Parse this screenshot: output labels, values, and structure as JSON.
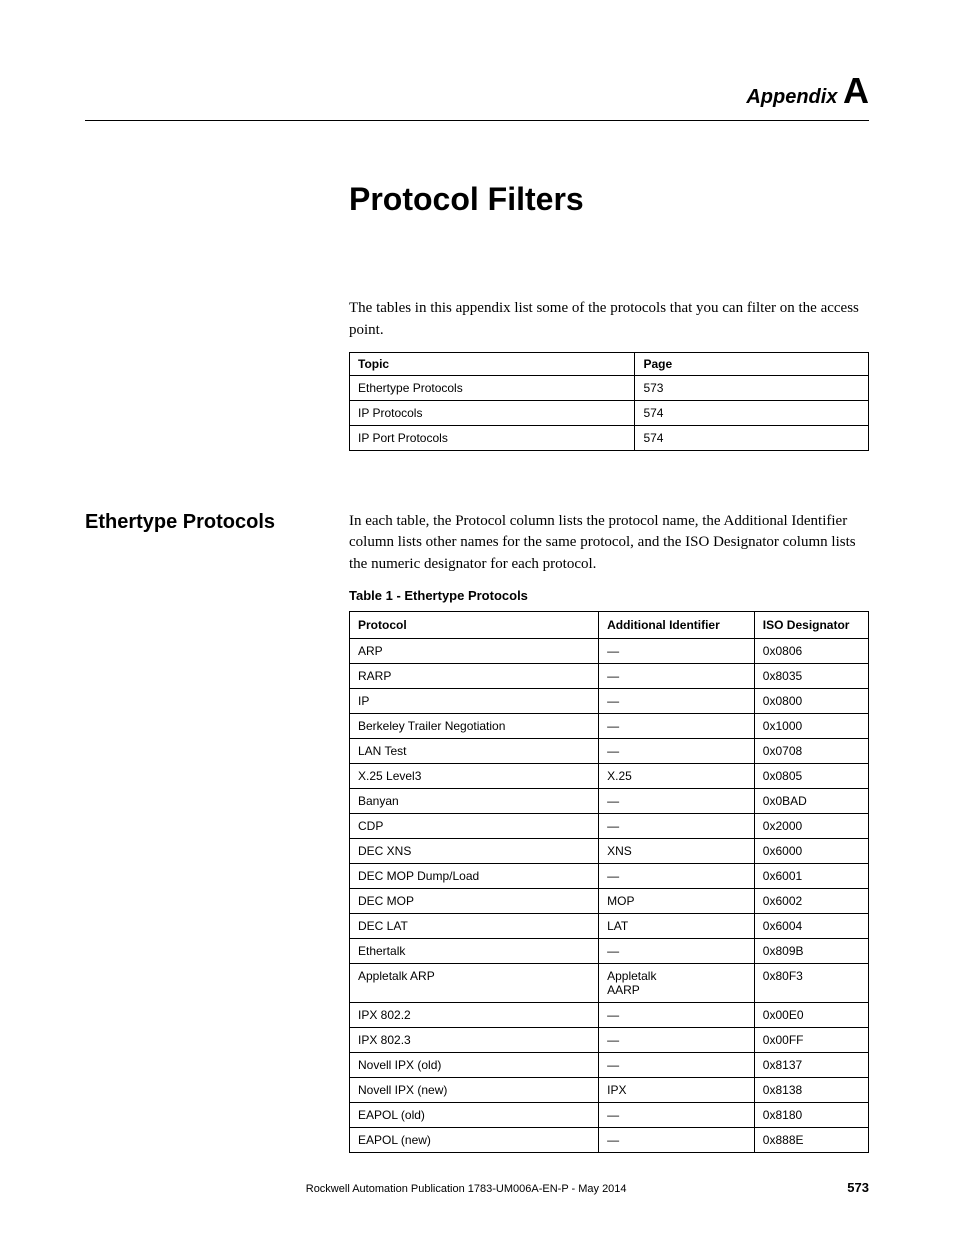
{
  "header": {
    "appendix_word": "Appendix",
    "appendix_letter": "A"
  },
  "title": "Protocol Filters",
  "intro": "The tables in this appendix list some of the protocols that you can filter on the access point.",
  "toc": {
    "headers": [
      "Topic",
      "Page"
    ],
    "rows": [
      [
        "Ethertype Protocols",
        "573"
      ],
      [
        "IP Protocols",
        "574"
      ],
      [
        "IP Port Protocols",
        "574"
      ]
    ]
  },
  "section": {
    "heading": "Ethertype Protocols",
    "body": "In each table, the Protocol column lists the protocol name, the Additional Identifier column lists other names for the same protocol, and the ISO Designator column lists the numeric designator for each protocol.",
    "table_caption": "Table 1 - Ethertype Protocols"
  },
  "chart_data": {
    "type": "table",
    "headers": [
      "Protocol",
      "Additional Identifier",
      "ISO Designator"
    ],
    "rows": [
      [
        "ARP",
        "—",
        "0x0806"
      ],
      [
        "RARP",
        "—",
        "0x8035"
      ],
      [
        "IP",
        "—",
        "0x0800"
      ],
      [
        "Berkeley Trailer Negotiation",
        "—",
        "0x1000"
      ],
      [
        "LAN Test",
        "—",
        "0x0708"
      ],
      [
        "X.25 Level3",
        "X.25",
        "0x0805"
      ],
      [
        "Banyan",
        "—",
        "0x0BAD"
      ],
      [
        "CDP",
        "—",
        "0x2000"
      ],
      [
        "DEC XNS",
        "XNS",
        "0x6000"
      ],
      [
        "DEC MOP Dump/Load",
        "—",
        "0x6001"
      ],
      [
        "DEC MOP",
        "MOP",
        "0x6002"
      ],
      [
        "DEC LAT",
        "LAT",
        "0x6004"
      ],
      [
        "Ethertalk",
        "—",
        "0x809B"
      ],
      [
        "Appletalk ARP",
        "Appletalk\nAARP",
        "0x80F3"
      ],
      [
        "IPX 802.2",
        "—",
        "0x00E0"
      ],
      [
        "IPX 802.3",
        "—",
        "0x00FF"
      ],
      [
        "Novell IPX (old)",
        "—",
        "0x8137"
      ],
      [
        "Novell IPX (new)",
        "IPX",
        "0x8138"
      ],
      [
        "EAPOL (old)",
        "—",
        "0x8180"
      ],
      [
        "EAPOL (new)",
        "—",
        "0x888E"
      ]
    ]
  },
  "footer": {
    "publication": "Rockwell Automation Publication 1783-UM006A-EN-P - May 2014",
    "page": "573"
  }
}
